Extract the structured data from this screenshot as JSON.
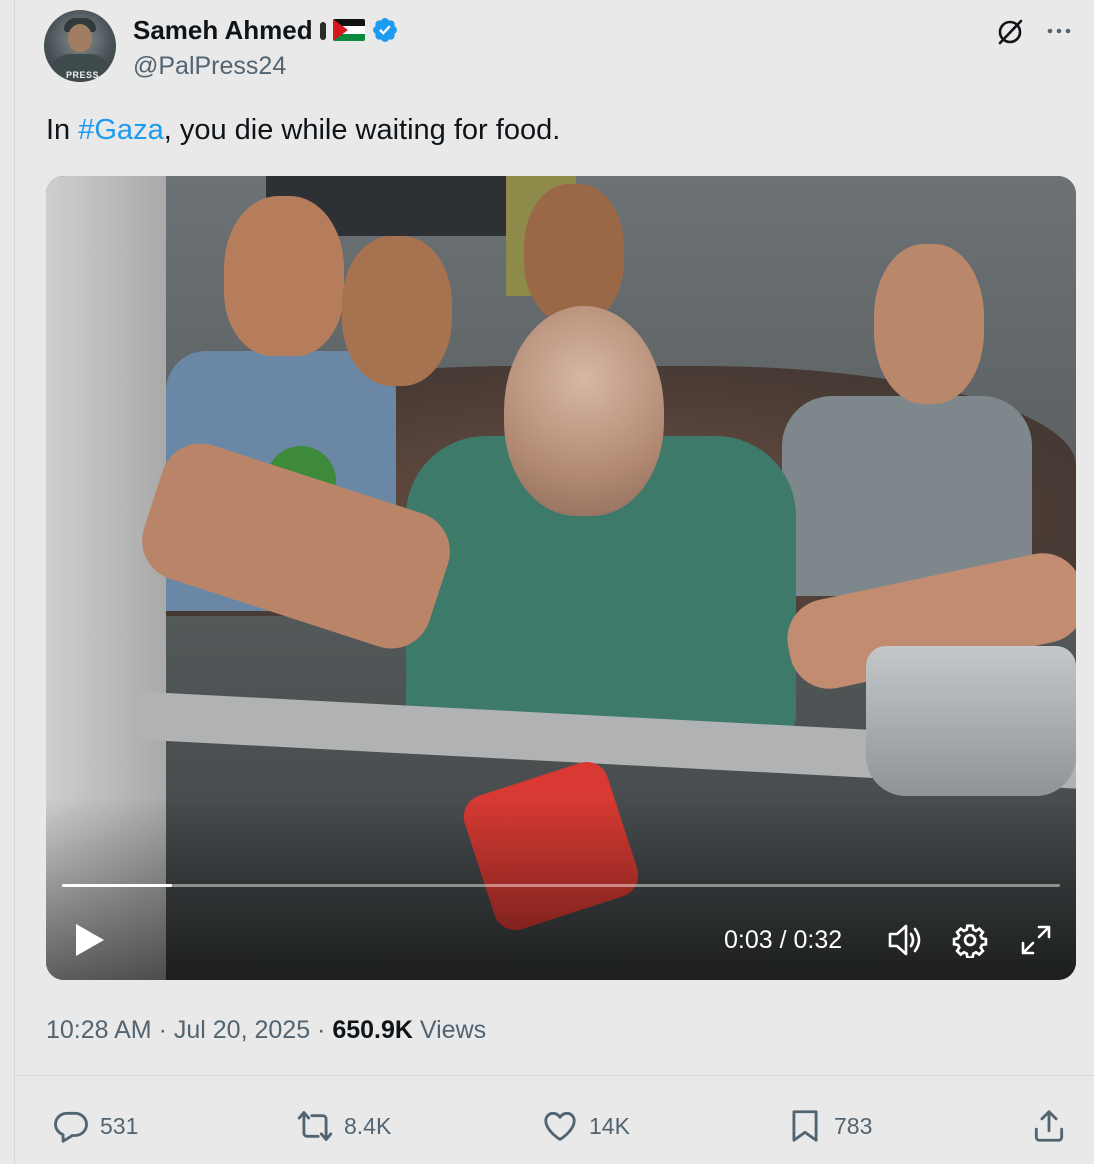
{
  "author": {
    "display_name": "Sameh Ahmed",
    "handle": "@PalPress24",
    "avatar_badge_text": "PRESS",
    "verified": true
  },
  "tweet": {
    "text_before": "In ",
    "hashtag": "#Gaza",
    "text_after": ", you die while waiting for food."
  },
  "video": {
    "time_current": "0:03",
    "time_total": "0:32",
    "time_label": "0:03 / 0:32",
    "progress_fraction": 0.11
  },
  "meta": {
    "time": "10:28 AM",
    "date": "Jul 20, 2025",
    "views_count": "650.9K",
    "views_label": "Views"
  },
  "actions": {
    "replies": "531",
    "reposts": "8.4K",
    "likes": "14K",
    "bookmarks": "783"
  },
  "colors": {
    "accent": "#1d9bf0",
    "text": "#0f1419",
    "muted": "#536471",
    "background": "#e9e9e9"
  },
  "icons": [
    "grok-icon",
    "more-icon",
    "verified-icon",
    "play-icon",
    "volume-icon",
    "settings-icon",
    "fullscreen-icon",
    "reply-icon",
    "repost-icon",
    "like-icon",
    "bookmark-icon",
    "share-icon"
  ]
}
